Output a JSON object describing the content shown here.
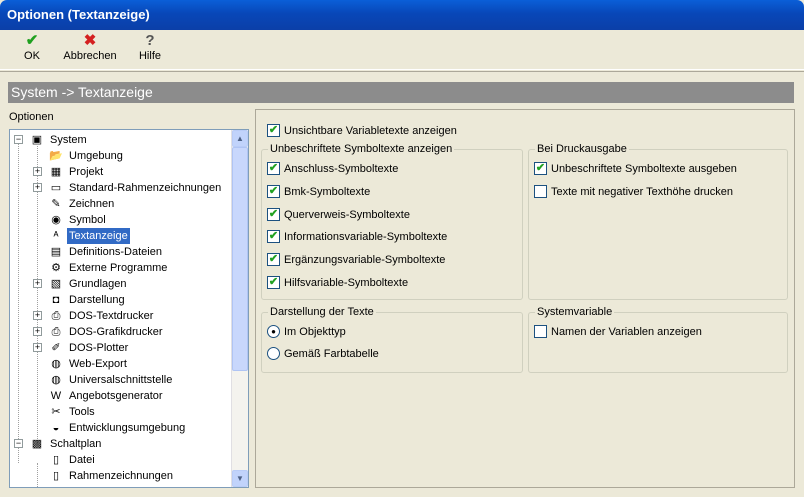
{
  "window": {
    "title": "Optionen (Textanzeige)"
  },
  "toolbar": {
    "ok": {
      "label": "OK",
      "icon": "checkmark-icon",
      "color": "#1FA01F"
    },
    "cancel": {
      "label": "Abbrechen",
      "icon": "cross-icon",
      "color": "#D42020"
    },
    "help": {
      "label": "Hilfe",
      "icon": "question-mark-icon"
    }
  },
  "header": {
    "title": "System -> Textanzeige"
  },
  "tree": {
    "label": "Optionen",
    "nodes": [
      {
        "label": "System",
        "icon": "system-icon",
        "level": 0,
        "expander": "−"
      },
      {
        "label": "Umgebung",
        "icon": "folder-open-icon",
        "level": 1
      },
      {
        "label": "Projekt",
        "icon": "project-icon",
        "level": 1,
        "expander": "+"
      },
      {
        "label": "Standard-Rahmenzeichnungen",
        "icon": "monitor-icon",
        "level": 1,
        "expander": "+"
      },
      {
        "label": "Zeichnen",
        "icon": "pencil-icon",
        "level": 1
      },
      {
        "label": "Symbol",
        "icon": "symbol-icon",
        "level": 1
      },
      {
        "label": "Textanzeige",
        "icon": "abc-text-icon",
        "level": 1,
        "selected": true
      },
      {
        "label": "Definitions-Dateien",
        "icon": "definition-file-icon",
        "level": 1
      },
      {
        "label": "Externe Programme",
        "icon": "external-program-icon",
        "level": 1
      },
      {
        "label": "Grundlagen",
        "icon": "basics-icon",
        "level": 1,
        "expander": "+"
      },
      {
        "label": "Darstellung",
        "icon": "display-icon",
        "level": 1
      },
      {
        "label": "DOS-Textdrucker",
        "icon": "printer-icon",
        "level": 1,
        "expander": "+"
      },
      {
        "label": "DOS-Grafikdrucker",
        "icon": "printer-icon",
        "level": 1,
        "expander": "+"
      },
      {
        "label": "DOS-Plotter",
        "icon": "plotter-icon",
        "level": 1,
        "expander": "+"
      },
      {
        "label": "Web-Export",
        "icon": "globe-icon",
        "level": 1
      },
      {
        "label": "Universalschnittstelle",
        "icon": "globe-icon",
        "level": 1
      },
      {
        "label": "Angebotsgenerator",
        "icon": "word-icon",
        "level": 1
      },
      {
        "label": "Tools",
        "icon": "tools-icon",
        "level": 1
      },
      {
        "label": "Entwicklungsumgebung",
        "icon": "development-icon",
        "level": 1
      },
      {
        "label": "Schaltplan",
        "icon": "schematic-icon",
        "level": 0,
        "expander": "−"
      },
      {
        "label": "Datei",
        "icon": "document-icon",
        "level": 1
      },
      {
        "label": "Rahmenzeichnungen",
        "icon": "document-icon",
        "level": 1
      }
    ]
  },
  "options": {
    "invisible": {
      "label": "Unsichtbare Variabletexte anzeigen",
      "checked": true
    },
    "unlabeled_group": {
      "title": "Unbeschriftete Symboltexte anzeigen",
      "items": [
        {
          "label": "Anschluss-Symboltexte",
          "checked": true
        },
        {
          "label": "Bmk-Symboltexte",
          "checked": true
        },
        {
          "label": "Querverweis-Symboltexte",
          "checked": true
        },
        {
          "label": "Informationsvariable-Symboltexte",
          "checked": true
        },
        {
          "label": "Ergänzungsvariable-Symboltexte",
          "checked": true
        },
        {
          "label": "Hilfsvariable-Symboltexte",
          "checked": true
        }
      ]
    },
    "print_group": {
      "title": "Bei Druckausgabe",
      "items": [
        {
          "label": "Unbeschriftete Symboltexte ausgeben",
          "checked": true
        },
        {
          "label": "Texte mit negativer Texthöhe drucken",
          "checked": false
        }
      ]
    },
    "display_group": {
      "title": "Darstellung der Texte",
      "items": [
        {
          "label": "Im Objekttyp",
          "selected": true
        },
        {
          "label": "Gemäß Farbtabelle",
          "selected": false
        }
      ]
    },
    "sysvar_group": {
      "title": "Systemvariable",
      "items": [
        {
          "label": "Namen der Variablen anzeigen",
          "checked": false
        }
      ]
    }
  },
  "colors": {
    "selection": "#316AC5",
    "header_bar": "#8C8C8C",
    "titlebar": "#0A5FD8"
  }
}
